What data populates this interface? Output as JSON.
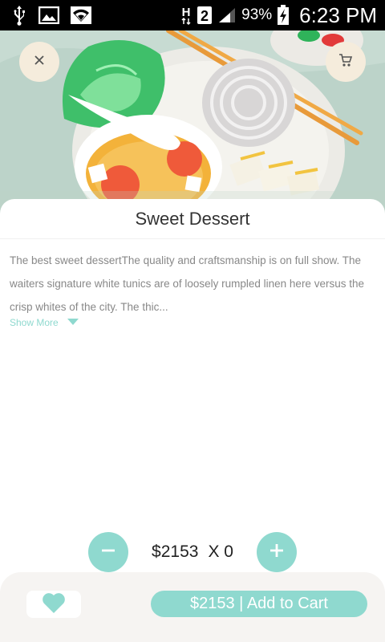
{
  "status_bar": {
    "battery_percent": "93%",
    "time": "6:23 PM",
    "sim_label": "2",
    "network_label": "H",
    "icons": [
      "usb-icon",
      "image-icon",
      "wifi-icon",
      "network-h-icon",
      "sim-2-icon",
      "signal-icon",
      "battery-charging-icon"
    ]
  },
  "header": {
    "close_icon": "close-icon",
    "cart_icon": "cart-icon"
  },
  "product": {
    "title": "Sweet Dessert",
    "description": "The best sweet dessertThe quality and craftsmanship is on full show. The waiters  signature white tunics are of loosely rumpled linen here versus the crisp whites of the city. The thic...",
    "show_more_label": "Show More"
  },
  "quantity": {
    "price": "$2153",
    "multiplier": "X 0"
  },
  "bottom_bar": {
    "add_to_cart_label": "$2153 | Add to Cart"
  },
  "colors": {
    "accent": "#8fd9cf",
    "button_bg": "#f5ecdc",
    "bottom_bar_bg": "#f6f4f2",
    "text_dark": "#333333",
    "text_muted": "#888888"
  }
}
